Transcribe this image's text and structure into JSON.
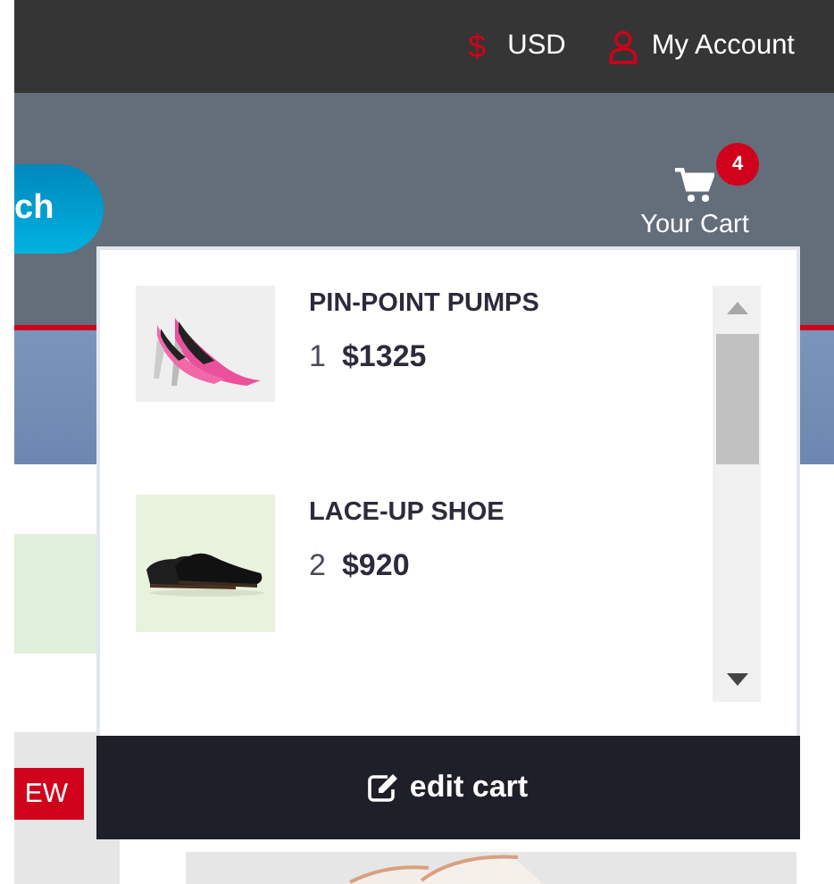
{
  "top_bar": {
    "currency_symbol": "$",
    "currency": "USD",
    "account": "My Account"
  },
  "header": {
    "search_button": "ch",
    "cart": {
      "count": "4",
      "label": "Your Cart"
    }
  },
  "cart_dropdown": {
    "items": [
      {
        "name": "PIN-POINT PUMPS",
        "quantity": "1",
        "price": "$1325",
        "kind": "picture"
      },
      {
        "name": "LACE-UP SHOE",
        "quantity": "2",
        "price": "$920",
        "kind": "picture"
      }
    ],
    "edit_button": "edit cart"
  },
  "background": {
    "badge": "EW"
  }
}
